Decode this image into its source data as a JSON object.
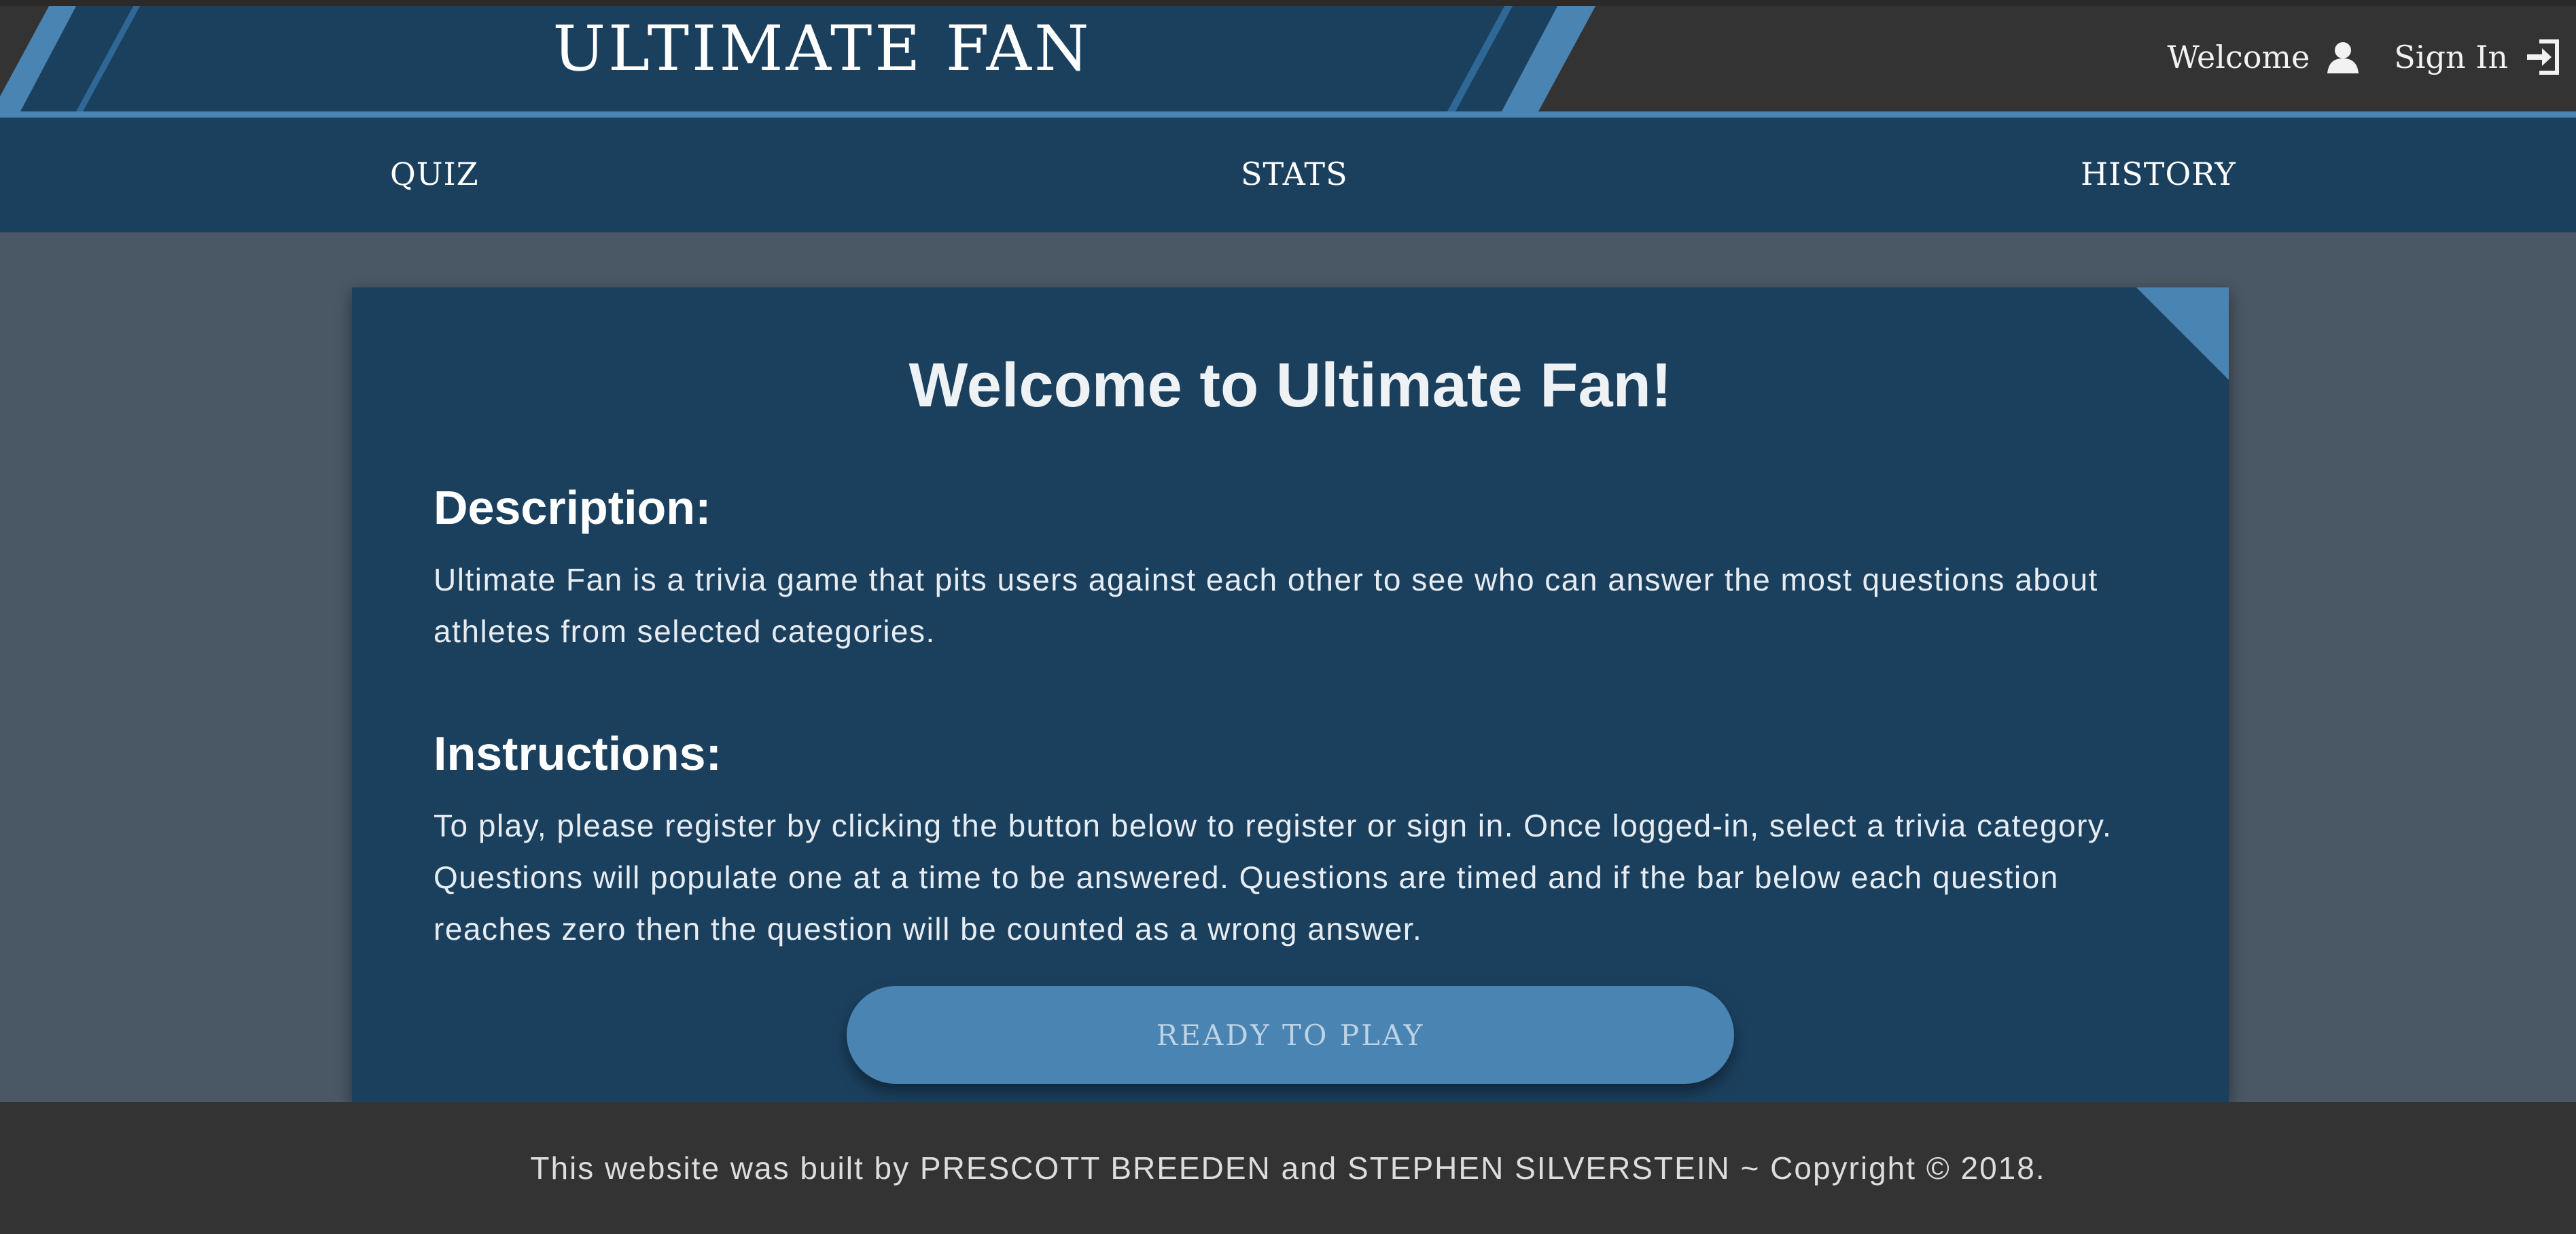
{
  "header": {
    "site_title": "ULTIMATE FAN",
    "welcome_label": "Welcome",
    "welcome_icon": "user-icon",
    "sign_in_label": "Sign In",
    "sign_in_icon": "sign-in-icon"
  },
  "nav": {
    "items": [
      {
        "label": "QUIZ"
      },
      {
        "label": "STATS"
      },
      {
        "label": "HISTORY"
      }
    ]
  },
  "main": {
    "heading": "Welcome to Ultimate Fan!",
    "description_title": "Description:",
    "description_text": "Ultimate Fan is a trivia game that pits users against each other to see who can answer the most questions about athletes from selected categories.",
    "instructions_title": "Instructions:",
    "instructions_text": "To play, please register by clicking the button below to register or sign in. Once logged-in, select a trivia category. Questions will populate one at a time to be answered. Questions are timed and if the bar below each question reaches zero then the question will be counted as a wrong answer.",
    "play_button_label": "READY TO PLAY"
  },
  "footer": {
    "text": "This website was built by PRESCOTT BREEDEN and STEPHEN SILVERSTEIN ~ Copyright © 2018."
  },
  "colors": {
    "header_bg": "#333333",
    "banner_bg": "#1b405e",
    "accent": "#4a84b2",
    "page_bg": "#4a5865",
    "card_bg": "#1b405e",
    "button_text": "#bcd3e6"
  }
}
